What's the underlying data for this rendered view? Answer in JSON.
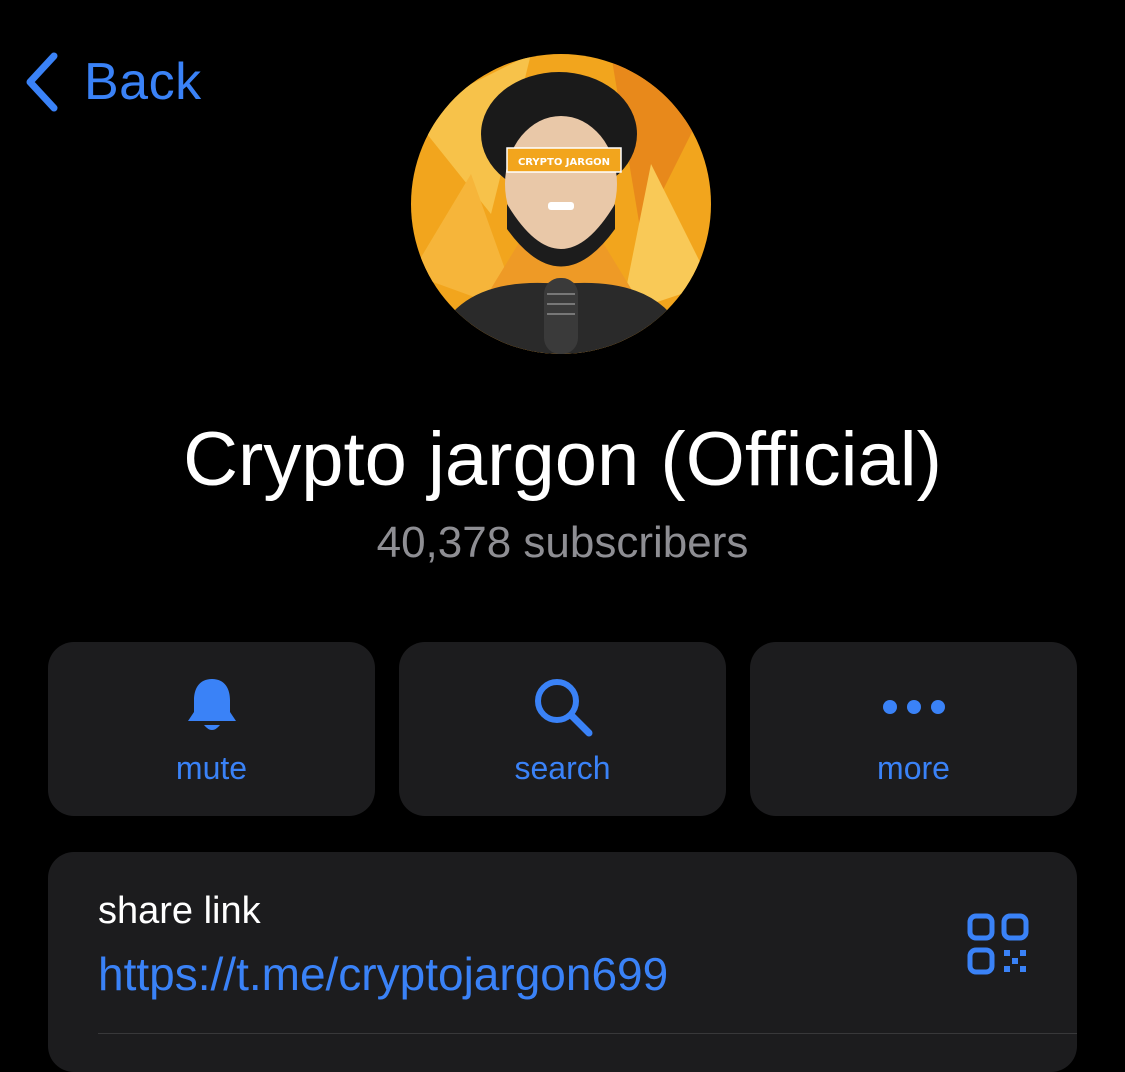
{
  "nav": {
    "back_label": "Back",
    "back_icon": "chevron-left-icon",
    "accent_color": "#3a82f7"
  },
  "profile": {
    "avatar_text": "CRYPTO JARGON",
    "name": "Crypto jargon (Official)",
    "subscribers": "40,378 subscribers"
  },
  "actions": [
    {
      "label": "mute",
      "icon": "bell-icon"
    },
    {
      "label": "search",
      "icon": "search-icon"
    },
    {
      "label": "more",
      "icon": "more-dots-icon"
    }
  ],
  "share": {
    "label": "share link",
    "url": "https://t.me/cryptojargon699",
    "icon": "qr-code-icon"
  }
}
